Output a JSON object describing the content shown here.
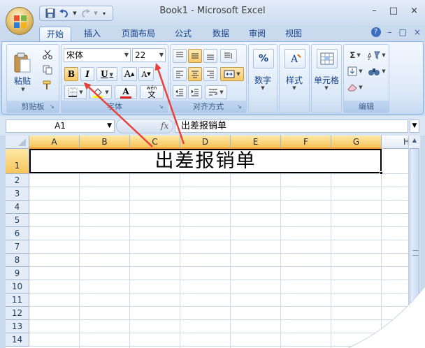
{
  "window": {
    "title": "Book1 - Microsoft Excel",
    "controls": [
      "–",
      "□",
      "×"
    ]
  },
  "quick_access": {
    "icons": [
      "save-icon",
      "undo-icon",
      "redo-icon",
      "customize-icon"
    ]
  },
  "tabs": [
    {
      "label": "开始",
      "active": true
    },
    {
      "label": "插入"
    },
    {
      "label": "页面布局"
    },
    {
      "label": "公式"
    },
    {
      "label": "数据"
    },
    {
      "label": "审阅"
    },
    {
      "label": "视图"
    }
  ],
  "tab_right": {
    "help": "?",
    "minimize": "–",
    "restore": "□",
    "close": "×"
  },
  "ribbon": {
    "clipboard": {
      "label": "剪贴板",
      "paste_label": "粘贴"
    },
    "font": {
      "label": "字体",
      "font_name": "宋体",
      "font_size": "22",
      "bold": "B",
      "italic": "I",
      "underline": "U",
      "font_color_letter": "A",
      "phonetic_top": "wén",
      "phonetic_char": "文"
    },
    "alignment": {
      "label": "对齐方式"
    },
    "number": {
      "label": "数字",
      "symbol": "%"
    },
    "styles": {
      "label": "样式"
    },
    "cells": {
      "label": "单元格"
    },
    "editing": {
      "label": "编辑",
      "sum_symbol": "Σ"
    }
  },
  "formula_bar": {
    "name_box": "A1",
    "fx": "fx",
    "content": "出差报销单"
  },
  "sheet": {
    "columns": [
      "A",
      "B",
      "C",
      "D",
      "E",
      "F",
      "G",
      "H"
    ],
    "rows": [
      "1",
      "2",
      "3",
      "4",
      "5",
      "6",
      "7",
      "8",
      "9",
      "10",
      "11",
      "12",
      "13",
      "14"
    ],
    "merged_cell_text": "出差报销单"
  },
  "colors": {
    "accent_arrow": "#e8413b",
    "selected_header": "#f7c459"
  }
}
